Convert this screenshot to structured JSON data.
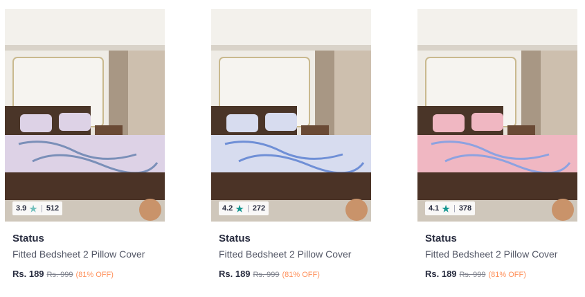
{
  "products": [
    {
      "rating": "3.9",
      "rating_count": "512",
      "brand": "Status",
      "title": "Fitted Bedsheet 2 Pillow Cover",
      "price": "Rs. 189",
      "mrp": "Rs. 999",
      "discount": "(81% OFF)",
      "star_color": "#72bfbc",
      "sheet_color": "#ddd2e6",
      "pattern_color": "#7a8fb8"
    },
    {
      "rating": "4.2",
      "rating_count": "272",
      "brand": "Status",
      "title": "Fitted Bedsheet 2 Pillow Cover",
      "price": "Rs. 189",
      "mrp": "Rs. 999",
      "discount": "(81% OFF)",
      "star_color": "#14958f",
      "sheet_color": "#d7dcef",
      "pattern_color": "#6f8fd6"
    },
    {
      "rating": "4.1",
      "rating_count": "378",
      "brand": "Status",
      "title": "Fitted Bedsheet 2 Pillow Cover",
      "price": "Rs. 189",
      "mrp": "Rs. 999",
      "discount": "(81% OFF)",
      "star_color": "#14958f",
      "sheet_color": "#f0b7c2",
      "pattern_color": "#8da2e0"
    }
  ]
}
